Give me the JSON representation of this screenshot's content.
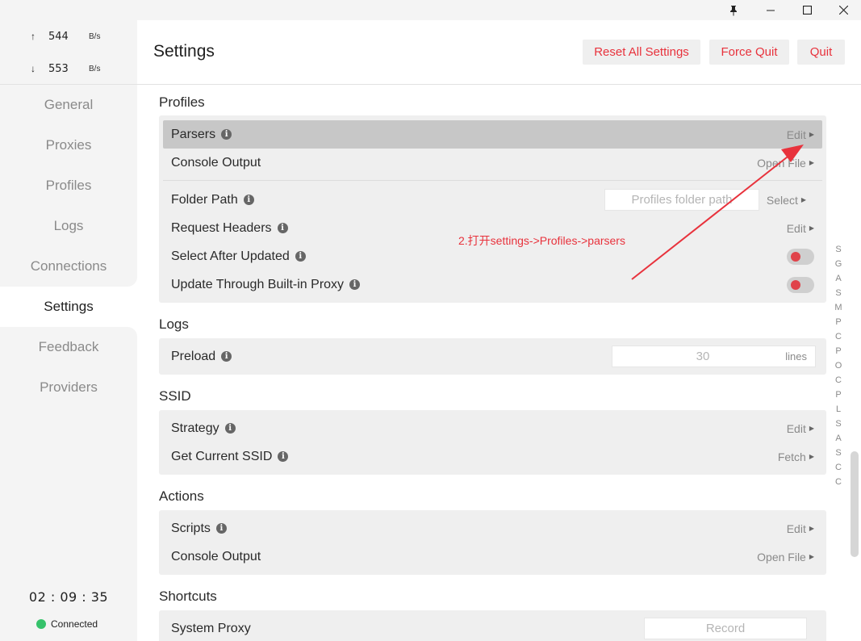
{
  "window": {
    "pin_icon": "pin-icon",
    "pin": "🖈",
    "minimize": "—",
    "maximize": "☐",
    "close": "✕"
  },
  "traffic": {
    "up_arrow": "↑",
    "up_value": "544",
    "up_unit": "B/s",
    "down_arrow": "↓",
    "down_value": "553",
    "down_unit": "B/s"
  },
  "nav": [
    {
      "label": "General"
    },
    {
      "label": "Proxies"
    },
    {
      "label": "Profiles"
    },
    {
      "label": "Logs"
    },
    {
      "label": "Connections"
    },
    {
      "label": "Settings"
    },
    {
      "label": "Feedback"
    },
    {
      "label": "Providers"
    }
  ],
  "status": {
    "clock": "02 : 09 : 35",
    "connection": "Connected",
    "connection_color": "#36c26b"
  },
  "header": {
    "title": "Settings",
    "reset_label": "Reset All Settings",
    "force_quit_label": "Force Quit",
    "quit_label": "Quit",
    "button_text_color": "#e8323c"
  },
  "profiles": {
    "title": "Profiles",
    "parsers": {
      "label": "Parsers",
      "action": "Edit"
    },
    "console_output": {
      "label": "Console Output",
      "action": "Open File"
    },
    "folder_path": {
      "label": "Folder Path",
      "placeholder": "Profiles folder path",
      "action": "Select"
    },
    "request_headers": {
      "label": "Request Headers",
      "action": "Edit"
    },
    "select_after_updated": {
      "label": "Select After Updated"
    },
    "update_through_proxy": {
      "label": "Update Through Built-in Proxy"
    }
  },
  "logs": {
    "title": "Logs",
    "preload": {
      "label": "Preload",
      "placeholder": "30",
      "unit": "lines"
    }
  },
  "ssid": {
    "title": "SSID",
    "strategy": {
      "label": "Strategy",
      "action": "Edit"
    },
    "current": {
      "label": "Get Current SSID",
      "action": "Fetch"
    }
  },
  "actions": {
    "title": "Actions",
    "scripts": {
      "label": "Scripts",
      "action": "Edit"
    },
    "console_output": {
      "label": "Console Output",
      "action": "Open File"
    }
  },
  "shortcuts": {
    "title": "Shortcuts",
    "system_proxy": {
      "label": "System Proxy",
      "placeholder": "Record"
    }
  },
  "annotation": "2.打开settings->Profiles->parsers",
  "index_letters": [
    "S",
    "G",
    "A",
    "S",
    "M",
    "P",
    "C",
    "P",
    "O",
    "C",
    "P",
    "L",
    "S",
    "A",
    "S",
    "C",
    "C"
  ]
}
